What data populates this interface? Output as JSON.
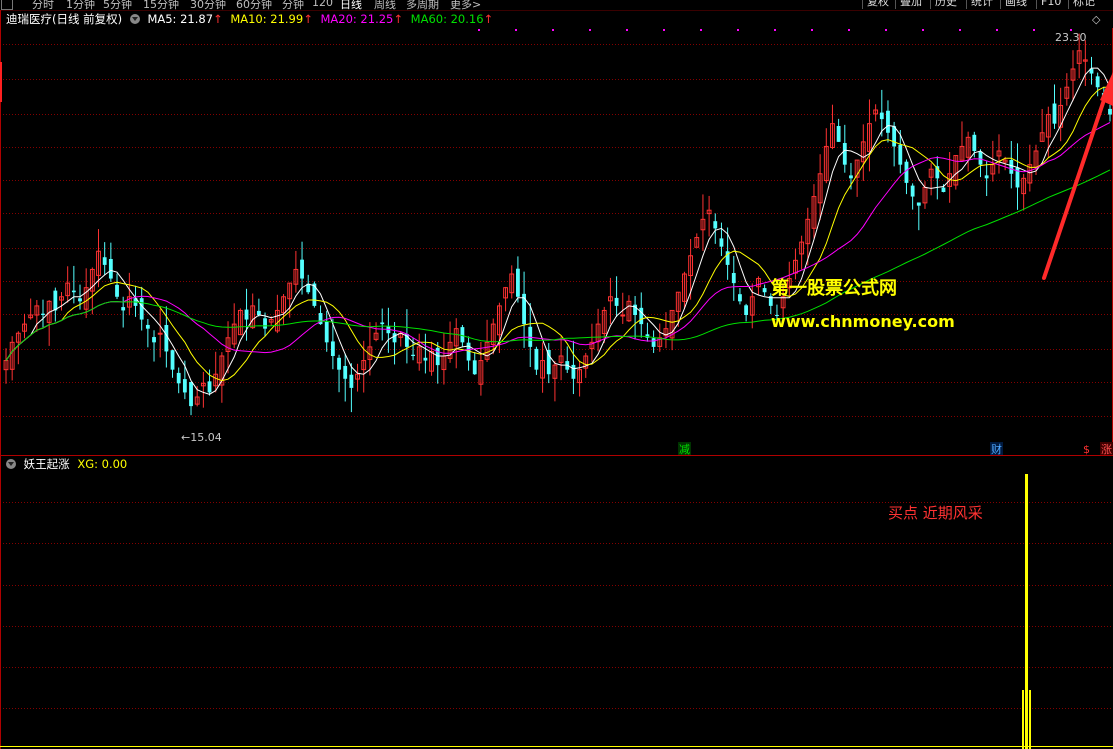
{
  "toolbar": {
    "period_tabs": [
      "分时",
      "1分钟",
      "5分钟",
      "15分钟",
      "30分钟",
      "60分钟",
      "分钟",
      "120",
      "日线",
      "周线",
      "多周期",
      "更多>"
    ],
    "active_tab": "日线",
    "tools": [
      "复权",
      "叠加",
      "历史",
      "统计",
      "画线",
      "F10",
      "标记"
    ]
  },
  "main_legend": {
    "title": "迪瑞医疗(日线 前复权)",
    "ma": [
      {
        "label": "MA5: 21.87",
        "color": "#ffffff"
      },
      {
        "label": "MA10: 21.99",
        "color": "#ffff00"
      },
      {
        "label": "MA20: 21.25",
        "color": "#ff00ff"
      },
      {
        "label": "MA60: 20.16",
        "color": "#00e000"
      }
    ],
    "up_arrow": "↑"
  },
  "sub_legend": {
    "title": "妖王起涨",
    "value_label": "XG: 0.00"
  },
  "annotations": {
    "high_label": "23.30",
    "low_label": "←15.04",
    "watermark_cn": "第一股票公式网",
    "watermark_url": "www.chnmoney.com",
    "buy_note": "买点 近期风采",
    "marker_jian": "减",
    "marker_cai": "财",
    "marker_dollar": "$",
    "marker_zhang": "涨",
    "diamond": "◇"
  },
  "colors": {
    "up": "#ff3232",
    "down": "#54ffff",
    "ma5": "#ffffff",
    "ma10": "#ffff00",
    "ma20": "#ff00ff",
    "ma60": "#00e000",
    "grid": "#840000",
    "signal": "#ffff00"
  },
  "chart_data": [
    {
      "type": "candlestick",
      "title": "迪瑞医疗(日线 前复权)",
      "ylim": [
        14.5,
        23.5
      ],
      "high_marker": 23.3,
      "low_marker": 15.04,
      "close": [
        16.2,
        16.6,
        16.8,
        17.0,
        17.2,
        17.4,
        17.2,
        17.5,
        17.3,
        17.6,
        17.9,
        17.7,
        17.5,
        17.8,
        18.2,
        18.6,
        18.3,
        18.0,
        17.6,
        17.3,
        17.6,
        17.4,
        17.1,
        16.9,
        16.6,
        16.8,
        16.4,
        16.0,
        15.7,
        15.5,
        15.2,
        15.4,
        15.7,
        15.5,
        15.9,
        16.3,
        16.7,
        17.0,
        17.3,
        17.1,
        17.4,
        17.2,
        16.9,
        17.1,
        17.3,
        17.6,
        17.9,
        18.2,
        18.0,
        17.7,
        17.4,
        17.0,
        16.6,
        16.3,
        16.0,
        15.8,
        15.6,
        15.9,
        16.2,
        16.5,
        16.8,
        17.0,
        16.8,
        16.6,
        16.8,
        16.5,
        16.3,
        16.5,
        16.2,
        16.4,
        16.1,
        16.3,
        16.6,
        16.9,
        16.6,
        16.2,
        15.9,
        16.2,
        16.6,
        17.0,
        17.4,
        17.8,
        18.1,
        17.6,
        17.0,
        16.5,
        16.0,
        16.2,
        15.9,
        16.1,
        16.3,
        16.0,
        15.8,
        16.0,
        16.3,
        16.6,
        17.0,
        17.3,
        17.6,
        17.4,
        17.2,
        17.5,
        17.2,
        17.0,
        16.7,
        16.5,
        16.7,
        16.9,
        17.3,
        17.7,
        18.1,
        18.5,
        18.9,
        19.3,
        19.5,
        19.1,
        18.7,
        18.3,
        17.9,
        17.5,
        17.2,
        17.6,
        18.0,
        17.7,
        17.4,
        17.2,
        17.6,
        18.0,
        18.4,
        18.8,
        19.3,
        19.8,
        20.3,
        20.9,
        21.4,
        21.0,
        20.5,
        20.2,
        20.6,
        21.0,
        21.4,
        21.7,
        21.5,
        21.2,
        20.9,
        20.5,
        20.1,
        19.8,
        19.6,
        20.0,
        20.4,
        20.2,
        19.9,
        20.3,
        20.7,
        20.9,
        21.1,
        20.8,
        20.5,
        20.2,
        20.5,
        20.8,
        20.6,
        20.3,
        20.0,
        20.2,
        20.5,
        20.8,
        21.2,
        21.6,
        21.4,
        21.8,
        22.2,
        22.6,
        23.0,
        22.8,
        22.5,
        22.2,
        21.9,
        21.6
      ],
      "MA5": 21.87,
      "MA10": 21.99,
      "MA20": 21.25,
      "MA60": 20.16
    },
    {
      "type": "bar",
      "title": "妖王起涨",
      "series": [
        {
          "name": "XG",
          "last_value": 0.0,
          "signal_index": 178,
          "signal_value": 1.0
        }
      ],
      "ylim": [
        0,
        1
      ]
    }
  ]
}
